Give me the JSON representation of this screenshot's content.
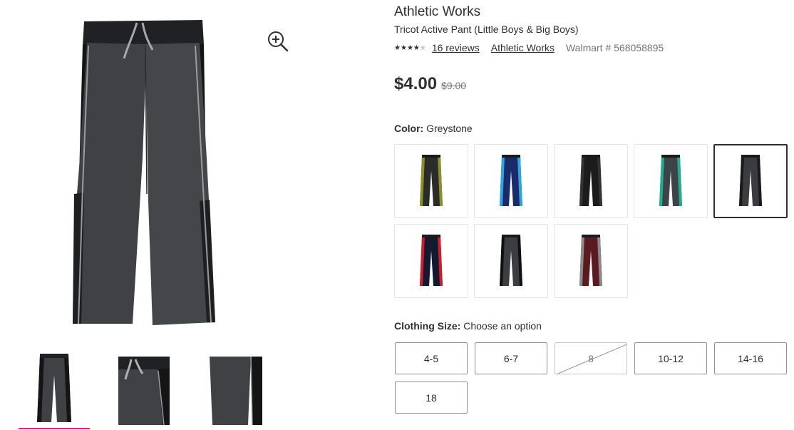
{
  "product": {
    "brand": "Athletic Works",
    "name": "Tricot Active Pant (Little Boys & Big Boys)",
    "rating": 4,
    "reviews_label": "16 reviews",
    "brand_link": "Athletic Works",
    "sku_label": "Walmart # 568058895",
    "price": "$4.00",
    "was_price": "$9.00"
  },
  "color": {
    "label": "Color:",
    "selected": "Greystone",
    "swatches": [
      {
        "name": "black-yellow",
        "body": "#2a2c2a",
        "stripe": "#8a8f2a"
      },
      {
        "name": "navy-blue",
        "body": "#1a2a6a",
        "stripe": "#29a8e0"
      },
      {
        "name": "black",
        "body": "#1c1c1c",
        "stripe": "#333333"
      },
      {
        "name": "grey-teal",
        "body": "#3d4348",
        "stripe": "#1bb08a"
      },
      {
        "name": "greystone",
        "body": "#3a3c40",
        "stripe": "#1a1a1a"
      },
      {
        "name": "navy-red",
        "body": "#111a30",
        "stripe": "#d01c2a"
      },
      {
        "name": "charcoal-black",
        "body": "#3c3d40",
        "stripe": "#111111"
      },
      {
        "name": "maroon",
        "body": "#5a1a20",
        "stripe": "#8a8a8a"
      }
    ]
  },
  "size": {
    "label": "Clothing Size:",
    "prompt": "Choose an option",
    "options": [
      {
        "label": "4-5",
        "available": true
      },
      {
        "label": "6-7",
        "available": true
      },
      {
        "label": "8",
        "available": false
      },
      {
        "label": "10-12",
        "available": true
      },
      {
        "label": "14-16",
        "available": true
      },
      {
        "label": "18",
        "available": true
      }
    ]
  },
  "colors": {
    "pant_main": "#3f4145",
    "pant_panel": "#151515",
    "piping": "#9a9ca0",
    "drawstring": "#a8a8a8",
    "accent_underline": "#e91e8c"
  },
  "icons": {
    "zoom": "zoom-in-icon",
    "star": "star-icon"
  }
}
